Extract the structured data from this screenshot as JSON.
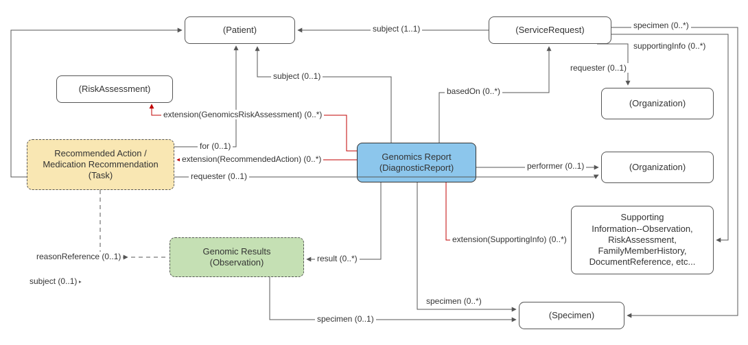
{
  "nodes": {
    "patient": "(Patient)",
    "risk": "(RiskAssessment)",
    "task_l1": "Recommended Action /",
    "task_l2": "Medication Recommendation",
    "task_l3": "(Task)",
    "results_l1": "Genomic Results",
    "results_l2": "(Observation)",
    "report_l1": "Genomics Report",
    "report_l2": "(DiagnosticReport)",
    "svcreq": "(ServiceRequest)",
    "org1": "(Organization)",
    "org2": "(Organization)",
    "supporting_l1": "Supporting",
    "supporting_l2": "Information--Observation,",
    "supporting_l3": "RiskAssessment,",
    "supporting_l4": "FamilyMemberHistory,",
    "supporting_l5": "DocumentReference, etc...",
    "specimen": "(Specimen)"
  },
  "edges": {
    "subject11": "subject (1..1)",
    "specimen0s": "specimen (0..*)",
    "supportingInfo0s": "supportingInfo (0..*)",
    "requester01_a": "requester (0..1)",
    "subject01_a": "subject (0..1)",
    "basedOn0s": "basedOn (0..*)",
    "extRisk": "extension(GenomicsRiskAssessment) (0..*)",
    "for01": "for (0..1)",
    "extRec": "extension(RecommendedAction) (0..*)",
    "requester01_b": "requester (0..1)",
    "performer01": "performer (0..1)",
    "extSupp": "extension(SupportingInfo) (0..*)",
    "result0s": "result (0..*)",
    "specimen01": "specimen (0..1)",
    "specimen0s_b": "specimen (0..*)",
    "reasonRef01": "reasonReference (0..1)",
    "subject01_b": "subject (0..1)"
  }
}
